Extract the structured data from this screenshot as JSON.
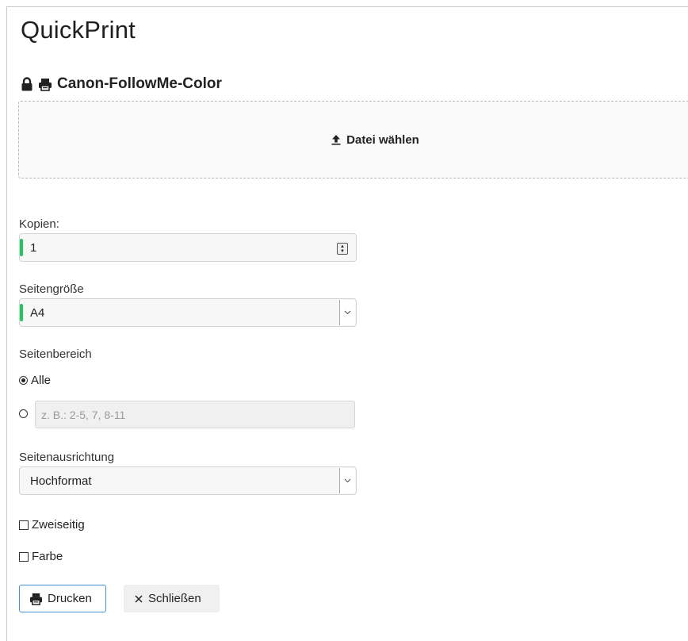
{
  "app": {
    "title": "QuickPrint"
  },
  "printer": {
    "name": "Canon-FollowMe-Color",
    "lock_icon": "lock-icon",
    "printer_icon": "printer-icon"
  },
  "upload": {
    "label": "Datei wählen",
    "icon": "upload-icon"
  },
  "copies": {
    "label": "Kopien:",
    "value": "1"
  },
  "page_size": {
    "label": "Seitengröße",
    "selected": "A4"
  },
  "page_range": {
    "label": "Seitenbereich",
    "option_all": "Alle",
    "option_all_checked": true,
    "custom_placeholder": "z. B.: 2-5, 7, 8-11"
  },
  "orientation": {
    "label": "Seitenausrichtung",
    "selected": "Hochformat"
  },
  "duplex": {
    "label": "Zweiseitig",
    "checked": false
  },
  "color": {
    "label": "Farbe",
    "checked": false
  },
  "buttons": {
    "print": "Drucken",
    "close": "Schließen"
  },
  "colors": {
    "accent_green": "#22c55e",
    "primary_border": "#4a90d9"
  }
}
